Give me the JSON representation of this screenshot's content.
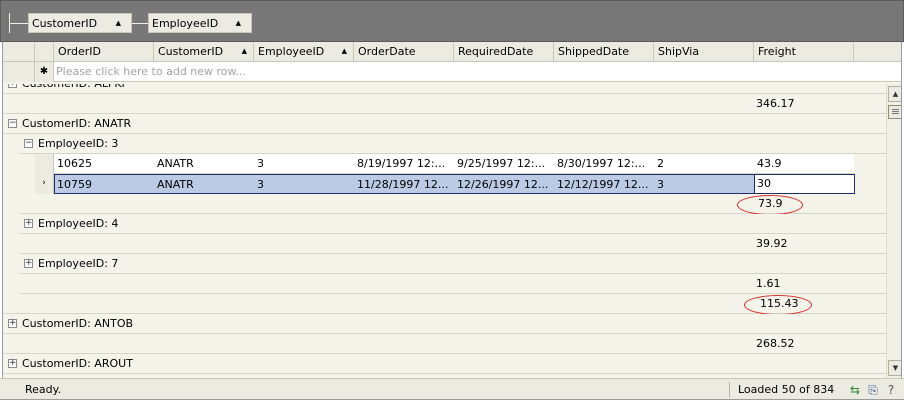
{
  "group_panel": {
    "chips": [
      {
        "label": "CustomerID",
        "sort": "▲"
      },
      {
        "label": "EmployeeID",
        "sort": "▲"
      }
    ]
  },
  "columns": [
    {
      "label": "OrderID",
      "sort": ""
    },
    {
      "label": "CustomerID",
      "sort": "▲"
    },
    {
      "label": "EmployeeID",
      "sort": "▲"
    },
    {
      "label": "OrderDate",
      "sort": ""
    },
    {
      "label": "RequiredDate",
      "sort": ""
    },
    {
      "label": "ShippedDate",
      "sort": ""
    },
    {
      "label": "ShipVia",
      "sort": ""
    },
    {
      "label": "Freight",
      "sort": ""
    }
  ],
  "new_row": {
    "star": "✱",
    "placeholder": "Please click here to add new row..."
  },
  "rows": {
    "alfki_label": "CustomerID: ALFKI",
    "alfki_sum": "346.17",
    "anatr_label": "CustomerID: ANATR",
    "emp3_label": "EmployeeID: 3",
    "order1": [
      "10625",
      "ANATR",
      "3",
      "8/19/1997 12:...",
      "9/25/1997 12:...",
      "8/30/1997 12:...",
      "2",
      "43.9"
    ],
    "order2": [
      "10759",
      "ANATR",
      "3",
      "11/28/1997 12...",
      "12/26/1997 12...",
      "12/12/1997 12...",
      "3",
      "30"
    ],
    "emp3_sum": "73.9",
    "emp4_label": "EmployeeID: 4",
    "emp4_sum": "39.92",
    "emp7_label": "EmployeeID: 7",
    "emp7_sum": "1.61",
    "anatr_sum": "115.43",
    "antob_label": "CustomerID: ANTOB",
    "antob_sum": "268.52",
    "arout_label": "CustomerID: AROUT",
    "expand": "+",
    "collapse": "−",
    "current_row": "›"
  },
  "status": {
    "ready": "Ready.",
    "loaded": "Loaded 50 of 834",
    "icons": [
      "refresh-icon",
      "export-icon",
      "help-icon"
    ]
  },
  "colors": {
    "selected_row": "#bccbe5",
    "highlight_oval": "#d62b2b",
    "group_bar": "#777777"
  }
}
